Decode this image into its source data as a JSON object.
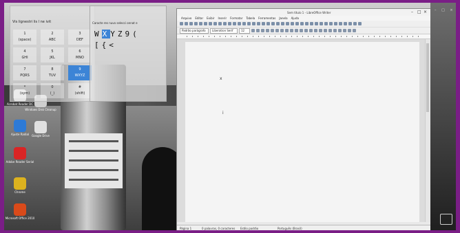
{
  "keypanel": {
    "title": "Vis  lignestri  lis  l  ne  ivit",
    "keys": [
      {
        "top": "1",
        "bottom": "(space)"
      },
      {
        "top": "2",
        "bottom": "ABC"
      },
      {
        "top": "3",
        "bottom": "DEF"
      },
      {
        "top": "4",
        "bottom": "GHI"
      },
      {
        "top": "5",
        "bottom": "JKL"
      },
      {
        "top": "6",
        "bottom": "MNO"
      },
      {
        "top": "7",
        "bottom": "PQRS"
      },
      {
        "top": "8",
        "bottom": "TUV"
      },
      {
        "top": "9",
        "bottom": "WXYZ"
      },
      {
        "top": "*",
        "bottom": "(sym)"
      },
      {
        "top": "0",
        "bottom": "(_)"
      },
      {
        "top": "#",
        "bottom": "(shift)"
      }
    ],
    "active_key": 8
  },
  "charpanel": {
    "title": "Caracte  res  nuvo  selecci  onnat  e",
    "row1": [
      "W",
      "X",
      "Y",
      "Z",
      "9",
      "("
    ],
    "row2": [
      "[",
      "{",
      "<"
    ],
    "selected": "X"
  },
  "desktop_icons": [
    {
      "name": "Acorp",
      "label": "Acrobat Reader DC",
      "color": "#d8d8d8"
    },
    {
      "name": "Settings",
      "label": "Ajuste Radial",
      "color": "#2d7ad6"
    },
    {
      "name": "Acrobat",
      "label": "Adobe Reader Serial",
      "color": "#d92525"
    },
    {
      "name": "Chrome",
      "label": "Chrome",
      "color": "#dcb21f"
    },
    {
      "name": "Office",
      "label": "Microsoft Office 2010",
      "color": "#d94a1a"
    }
  ],
  "desktop_icons_col2": [
    {
      "label": "Windows Disk Cleanup",
      "color": "#cfcfcf"
    },
    {
      "label": "Google Drive",
      "color": "#e0e0e0"
    }
  ],
  "writer": {
    "title": "Sem título 1 - LibreOffice Writer",
    "menu": [
      "Arquivo",
      "Editar",
      "Exibir",
      "Inserir",
      "Formatar",
      "Tabela",
      "Ferramentas",
      "Janela",
      "Ajuda"
    ],
    "style_box": "Padrão parágrafo",
    "font_box": "Liberation Serif",
    "size_box": "12",
    "doc_chars": [
      "x",
      "i"
    ],
    "status": {
      "page": "Página 1",
      "words": "0 palavras, 0 caracteres",
      "style": "Estilo padrão",
      "lang": "Português (Brasil)"
    }
  },
  "colors": {
    "frame": "#7a1e86",
    "accent": "#3c84d6"
  }
}
